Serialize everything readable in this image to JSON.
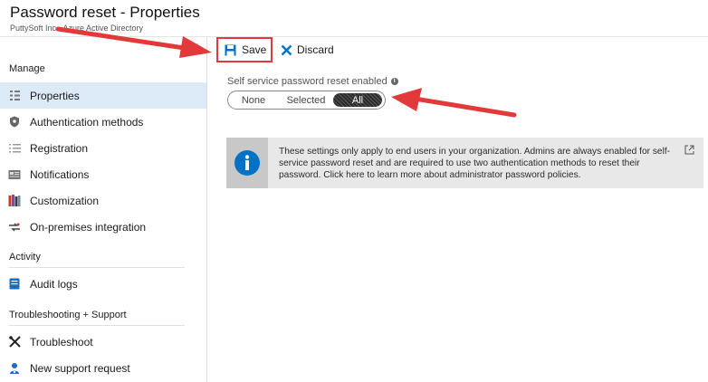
{
  "header": {
    "title": "Password reset - Properties",
    "subtitle": "PuttySoft Inc - Azure Active Directory",
    "collapse_label": "«"
  },
  "sidebar": {
    "manage_header": "Manage",
    "activity_header": "Activity",
    "troubleshooting_header": "Troubleshooting + Support",
    "items": [
      {
        "label": "Properties",
        "icon": "properties-icon"
      },
      {
        "label": "Authentication methods",
        "icon": "shield-icon"
      },
      {
        "label": "Registration",
        "icon": "list-icon"
      },
      {
        "label": "Notifications",
        "icon": "notifications-icon"
      },
      {
        "label": "Customization",
        "icon": "books-icon"
      },
      {
        "label": "On-premises integration",
        "icon": "sync-icon"
      },
      {
        "label": "Audit logs",
        "icon": "audit-log-icon"
      },
      {
        "label": "Troubleshoot",
        "icon": "tools-icon"
      },
      {
        "label": "New support request",
        "icon": "support-person-icon"
      }
    ]
  },
  "toolbar": {
    "save_label": "Save",
    "discard_label": "Discard"
  },
  "setting": {
    "label": "Self service password reset enabled",
    "info": "i",
    "options": [
      "None",
      "Selected",
      "All"
    ],
    "selected": "All"
  },
  "banner": {
    "text": "These settings only apply to end users in your organization. Admins are always enabled for self-service password reset and are required to use two authentication methods to reset their password. Click here to learn more about administrator password policies."
  },
  "colors": {
    "accent": "#0072c6",
    "active_bg": "#dce9f7",
    "annotation_red": "#e23a3a"
  }
}
